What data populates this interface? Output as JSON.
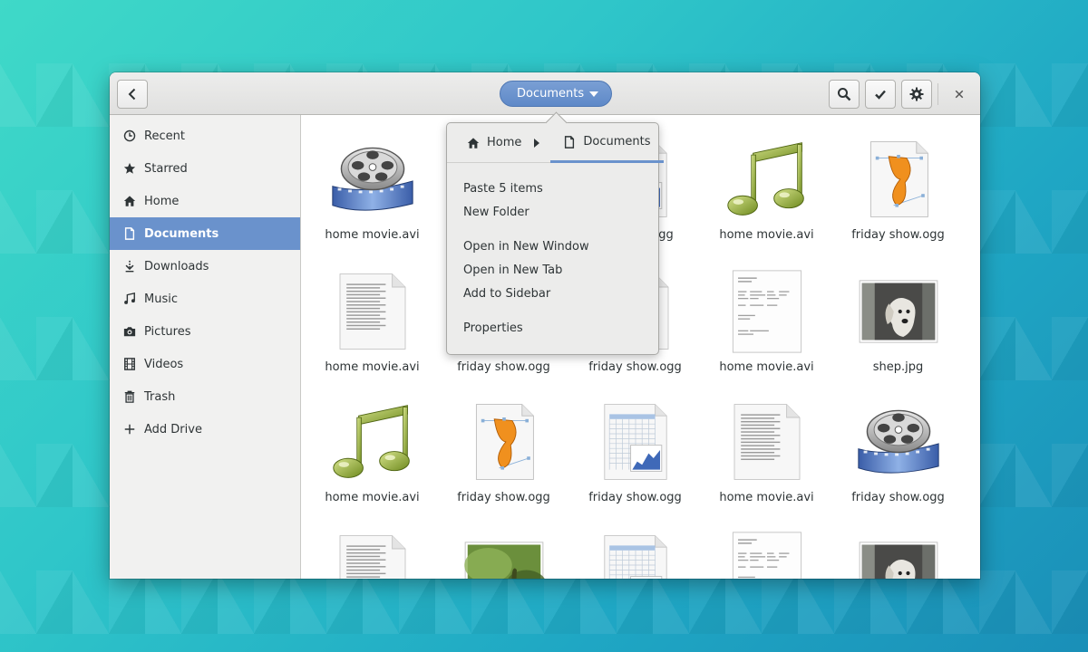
{
  "header": {
    "location_label": "Documents",
    "back_icon": "chevron-left-icon",
    "search_icon": "search-icon",
    "select_icon": "checkmark-icon",
    "settings_icon": "gear-icon",
    "close_icon": "close-icon"
  },
  "sidebar": {
    "items": [
      {
        "label": "Recent",
        "icon": "clock-icon"
      },
      {
        "label": "Starred",
        "icon": "star-icon"
      },
      {
        "label": "Home",
        "icon": "home-icon"
      },
      {
        "label": "Documents",
        "icon": "document-icon",
        "active": true
      },
      {
        "label": "Downloads",
        "icon": "download-icon"
      },
      {
        "label": "Music",
        "icon": "music-icon"
      },
      {
        "label": "Pictures",
        "icon": "camera-icon"
      },
      {
        "label": "Videos",
        "icon": "film-icon"
      },
      {
        "label": "Trash",
        "icon": "trash-icon"
      },
      {
        "label": "Add Drive",
        "icon": "plus-icon"
      }
    ]
  },
  "popover": {
    "crumbs": [
      {
        "label": "Home",
        "icon": "home-icon"
      },
      {
        "label": "Documents",
        "icon": "document-icon"
      }
    ],
    "menu": [
      [
        "Paste 5 items",
        "New Folder"
      ],
      [
        "Open in New Window",
        "Open in New Tab",
        "Add to Sidebar"
      ],
      [
        "Properties"
      ]
    ]
  },
  "files": [
    {
      "name": "home movie.avi",
      "kind": "video"
    },
    {
      "name": "",
      "kind": "hidden"
    },
    {
      "name": "ogg",
      "kind": "spreadsheet"
    },
    {
      "name": "home movie.avi",
      "kind": "music"
    },
    {
      "name": "friday show.ogg",
      "kind": "vector"
    },
    {
      "name": "home movie.avi",
      "kind": "text"
    },
    {
      "name": "friday show.ogg",
      "kind": "text"
    },
    {
      "name": "friday show.ogg",
      "kind": "text"
    },
    {
      "name": "home movie.avi",
      "kind": "form"
    },
    {
      "name": "shep.jpg",
      "kind": "photo"
    },
    {
      "name": "home movie.avi",
      "kind": "music"
    },
    {
      "name": "friday show.ogg",
      "kind": "vector"
    },
    {
      "name": "friday show.ogg",
      "kind": "spreadsheet"
    },
    {
      "name": "home movie.avi",
      "kind": "text"
    },
    {
      "name": "friday show.ogg",
      "kind": "video"
    },
    {
      "name": "",
      "kind": "text"
    },
    {
      "name": "",
      "kind": "photo-green"
    },
    {
      "name": "",
      "kind": "spreadsheet"
    },
    {
      "name": "",
      "kind": "form"
    },
    {
      "name": "",
      "kind": "photo"
    }
  ],
  "colors": {
    "accent": "#6a92cc",
    "sidebar_bg": "#f1f1f0",
    "header_bg": "#e6e6e5"
  }
}
